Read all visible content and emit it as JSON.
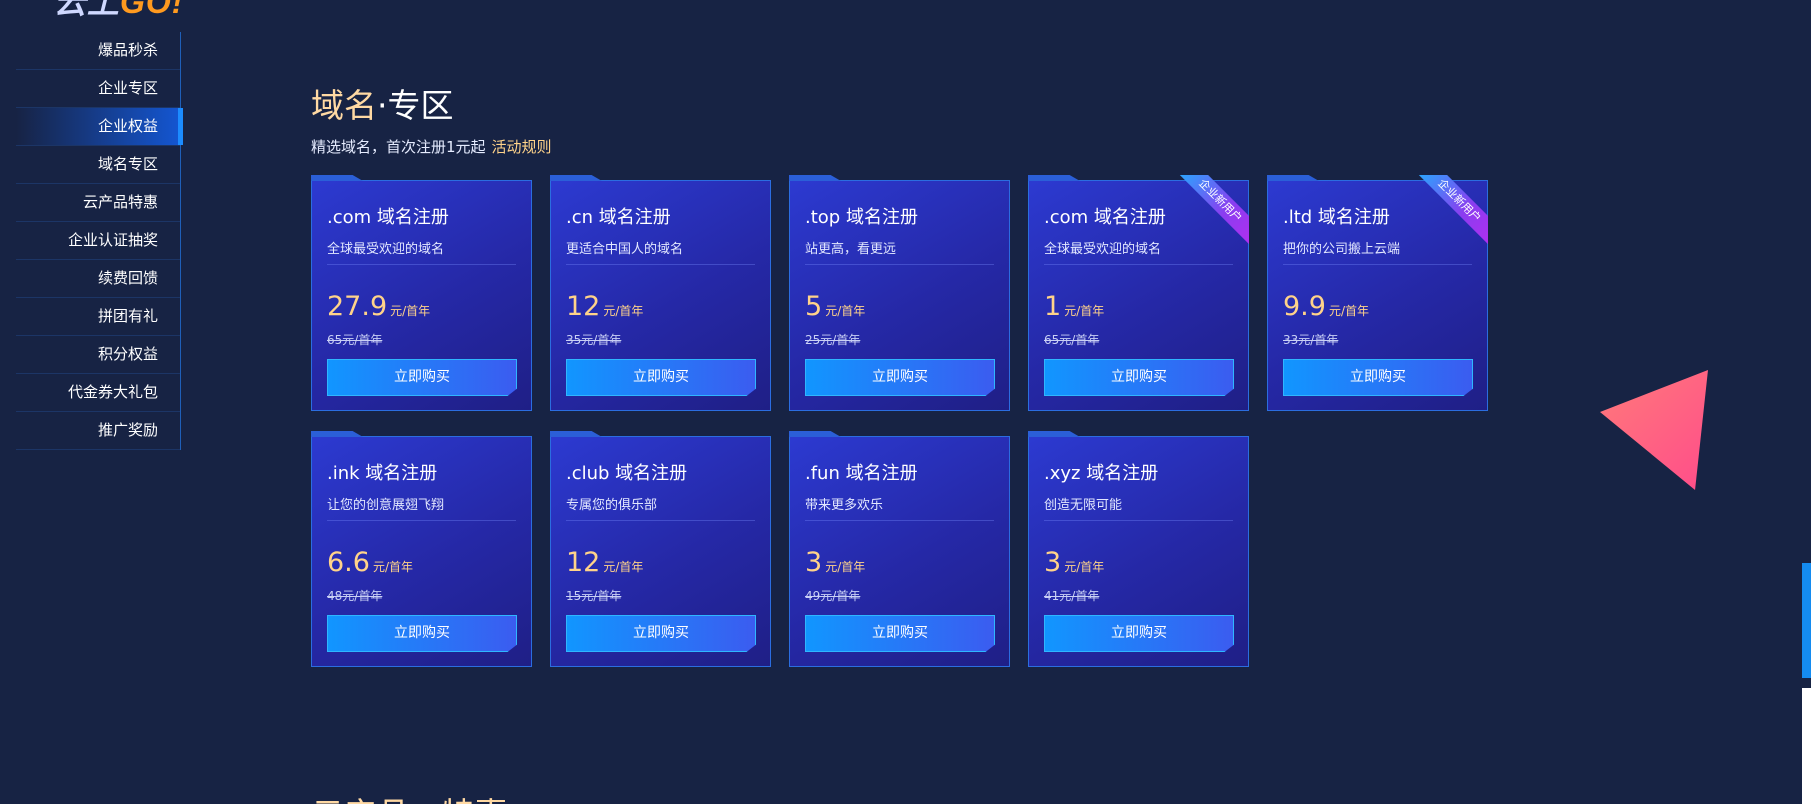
{
  "logo": {
    "part1": "云上",
    "part2": "GO!"
  },
  "sidebar": {
    "items": [
      {
        "label": "爆品秒杀"
      },
      {
        "label": "企业专区"
      },
      {
        "label": "企业权益"
      },
      {
        "label": "域名专区"
      },
      {
        "label": "云产品特惠"
      },
      {
        "label": "企业认证抽奖"
      },
      {
        "label": "续费回馈"
      },
      {
        "label": "拼团有礼"
      },
      {
        "label": "积分权益"
      },
      {
        "label": "代金券大礼包"
      },
      {
        "label": "推广奖励"
      }
    ],
    "active_index": 2
  },
  "section": {
    "title_part1": "域名",
    "title_sep": "·",
    "title_part2": "专区",
    "subtitle": "精选域名，首次注册1元起",
    "rule_link": "活动规则"
  },
  "cards": [
    {
      "title": ".com 域名注册",
      "desc": "全球最受欢迎的域名",
      "price": "27.9",
      "unit": "元/首年",
      "original": "65元/首年",
      "button": "立即购买",
      "ribbon": ""
    },
    {
      "title": ".cn 域名注册",
      "desc": "更适合中国人的域名",
      "price": "12",
      "unit": "元/首年",
      "original": "35元/首年",
      "button": "立即购买",
      "ribbon": ""
    },
    {
      "title": ".top 域名注册",
      "desc": "站更高，看更远",
      "price": "5",
      "unit": "元/首年",
      "original": "25元/首年",
      "button": "立即购买",
      "ribbon": ""
    },
    {
      "title": ".com 域名注册",
      "desc": "全球最受欢迎的域名",
      "price": "1",
      "unit": "元/首年",
      "original": "65元/首年",
      "button": "立即购买",
      "ribbon": "企业新用户"
    },
    {
      "title": ".ltd 域名注册",
      "desc": "把你的公司搬上云端",
      "price": "9.9",
      "unit": "元/首年",
      "original": "33元/首年",
      "button": "立即购买",
      "ribbon": "企业新用户"
    },
    {
      "title": ".ink 域名注册",
      "desc": "让您的创意展翅飞翔",
      "price": "6.6",
      "unit": "元/首年",
      "original": "48元/首年",
      "button": "立即购买",
      "ribbon": ""
    },
    {
      "title": ".club 域名注册",
      "desc": "专属您的俱乐部",
      "price": "12",
      "unit": "元/首年",
      "original": "15元/首年",
      "button": "立即购买",
      "ribbon": ""
    },
    {
      "title": ".fun 域名注册",
      "desc": "带来更多欢乐",
      "price": "3",
      "unit": "元/首年",
      "original": "49元/首年",
      "button": "立即购买",
      "ribbon": ""
    },
    {
      "title": ".xyz 域名注册",
      "desc": "创造无限可能",
      "price": "3",
      "unit": "元/首年",
      "original": "41元/首年",
      "button": "立即购买",
      "ribbon": ""
    }
  ],
  "next_section": {
    "title": "云产品 · 特惠"
  },
  "colors": {
    "background": "#172344",
    "accent_gold": "#ffd38a",
    "card_border": "#2b6de0",
    "button_start": "#1196ff",
    "button_end": "#3b5cf0"
  }
}
